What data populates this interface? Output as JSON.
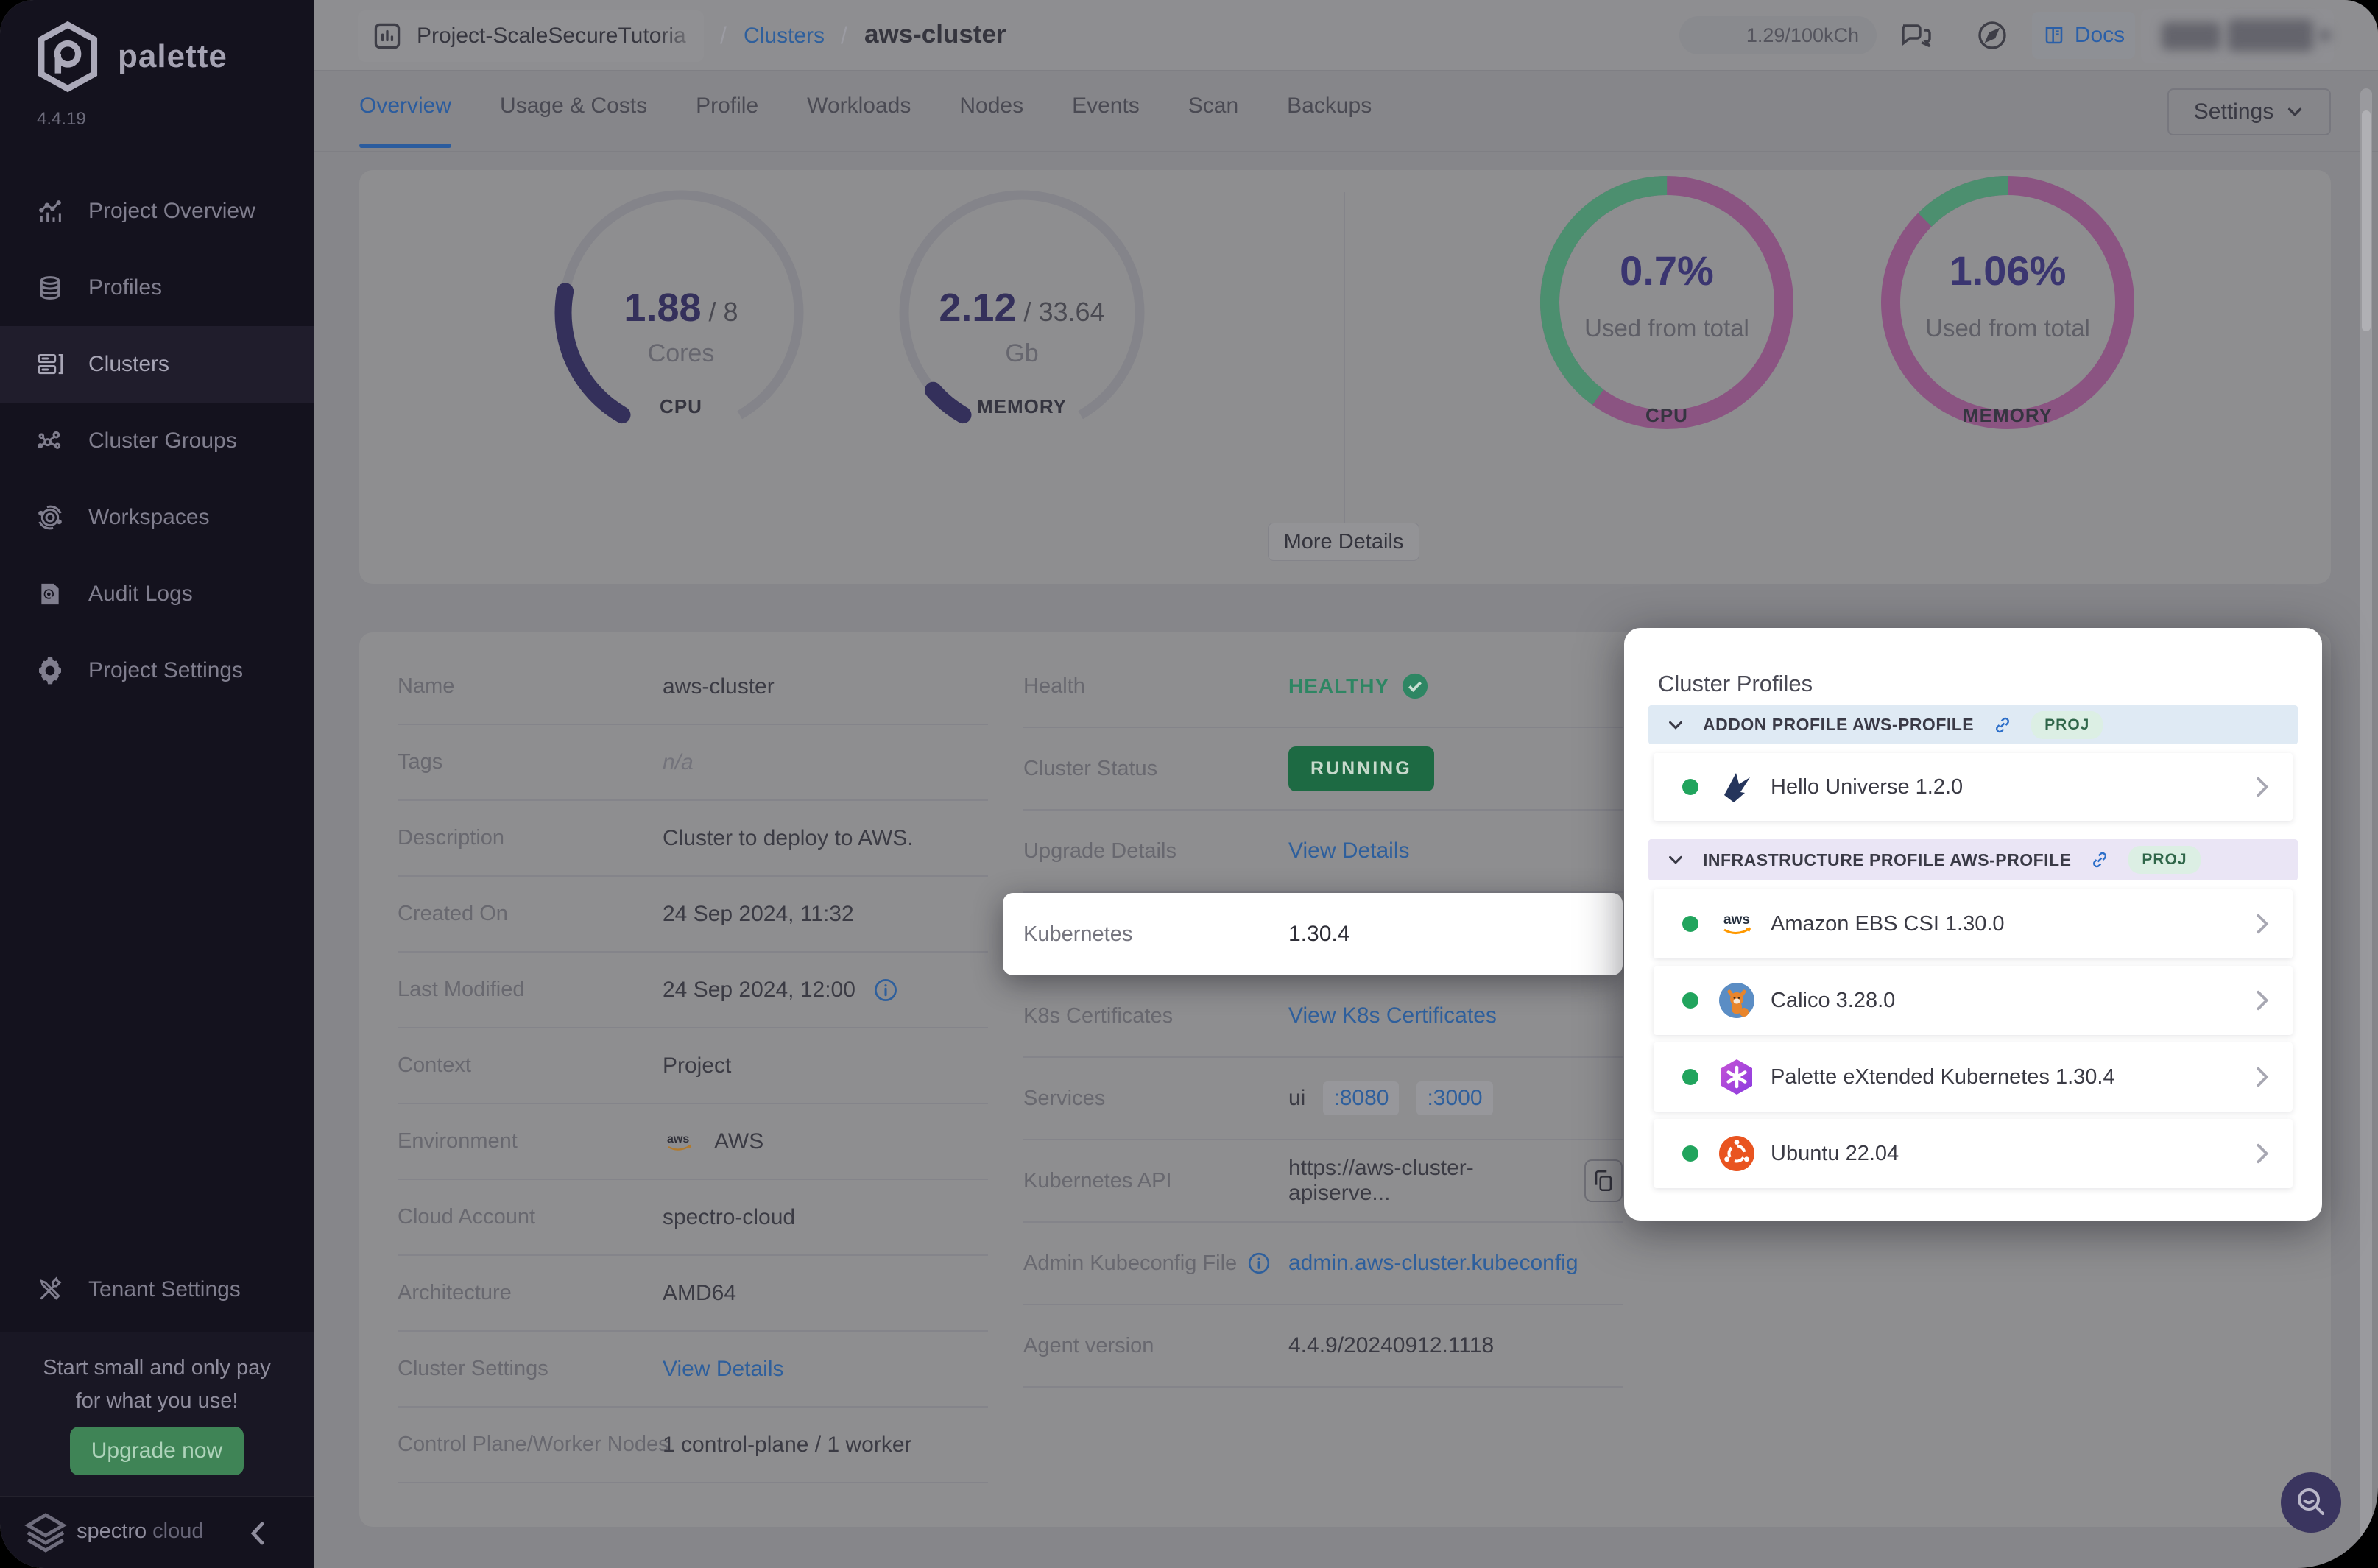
{
  "colors": {
    "accent_blue": "#2E5F9C",
    "panel_link_blue": "#2D6FC9",
    "healthy_green": "#2E8663",
    "running_badge_bg": "#1D6A43",
    "upgrade_button_green": "#3F8456",
    "gauge_indigo": "#34305B",
    "donut_green": "#4C8F6F",
    "donut_magenta": "#8B5482",
    "status_dot_green": "#21A45D",
    "fab_purple": "#3A355F"
  },
  "sidebar": {
    "brand": "palette",
    "version": "4.4.19",
    "items": [
      {
        "label": "Project Overview"
      },
      {
        "label": "Profiles"
      },
      {
        "label": "Clusters"
      },
      {
        "label": "Cluster Groups"
      },
      {
        "label": "Workspaces"
      },
      {
        "label": "Audit Logs"
      },
      {
        "label": "Project Settings"
      }
    ],
    "active_item": "Clusters",
    "tenant_settings": "Tenant Settings",
    "promo": {
      "text": "Start small and only pay for what you use!",
      "button": "Upgrade now"
    },
    "footer": {
      "brand1": "spectro",
      "brand2": "cloud"
    }
  },
  "topbar": {
    "project": "Project-ScaleSecureTutoria",
    "sep1": "/",
    "breadcrumb_link": "Clusters",
    "sep2": "/",
    "breadcrumb_current": "aws-cluster",
    "usage_badge": "1.29/100kCh",
    "docs_label": "Docs"
  },
  "tabs": {
    "items": [
      "Overview",
      "Usage & Costs",
      "Profile",
      "Workloads",
      "Nodes",
      "Events",
      "Scan",
      "Backups"
    ],
    "active": "Overview",
    "settings_button": "Settings"
  },
  "metrics": {
    "cpu_gauge": {
      "value": "1.88",
      "total": "/ 8",
      "unit": "Cores",
      "label": "CPU",
      "fraction": 0.235
    },
    "memory_gauge": {
      "value": "2.12",
      "total": "/ 33.64",
      "unit": "Gb",
      "label": "MEMORY",
      "fraction": 0.063
    },
    "cpu_donut": {
      "percent": "0.7%",
      "caption": "Used from total",
      "label": "CPU",
      "green_fraction": 0.4
    },
    "memory_donut": {
      "percent": "1.06%",
      "caption": "Used from total",
      "label": "MEMORY",
      "green_fraction": 0.125
    },
    "more_details": "More Details"
  },
  "details": {
    "left": [
      {
        "label": "Name",
        "value": "aws-cluster"
      },
      {
        "label": "Tags",
        "value": "n/a"
      },
      {
        "label": "Description",
        "value": "Cluster to deploy to AWS."
      },
      {
        "label": "Created On",
        "value": "24 Sep 2024, 11:32"
      },
      {
        "label": "Last Modified",
        "value": "24 Sep 2024, 12:00"
      },
      {
        "label": "Context",
        "value": "Project"
      },
      {
        "label": "Environment",
        "value": "AWS"
      },
      {
        "label": "Cloud Account",
        "value": "spectro-cloud"
      },
      {
        "label": "Architecture",
        "value": "AMD64"
      },
      {
        "label": "Cluster Settings",
        "value": "View Details"
      },
      {
        "label": "Control Plane/Worker Nodes",
        "value": "1 control-plane / 1 worker"
      }
    ],
    "right": {
      "health": {
        "label": "Health",
        "value": "HEALTHY"
      },
      "status": {
        "label": "Cluster Status",
        "value": "RUNNING"
      },
      "upgrade": {
        "label": "Upgrade Details",
        "value": "View Details"
      },
      "kubernetes": {
        "label": "Kubernetes",
        "value": "1.30.4"
      },
      "certs": {
        "label": "K8s Certificates",
        "value": "View K8s Certificates"
      },
      "services": {
        "label": "Services",
        "prefix": "ui",
        "ports": [
          ":8080",
          ":3000"
        ]
      },
      "api": {
        "label": "Kubernetes API",
        "value": "https://aws-cluster-apiserve..."
      },
      "kubeconfig": {
        "label": "Admin Kubeconfig File",
        "value": "admin.aws-cluster.kubeconfig"
      },
      "agent": {
        "label": "Agent version",
        "value": "4.4.9/20240912.1118"
      }
    }
  },
  "profiles_panel": {
    "title": "Cluster Profiles",
    "sections": [
      {
        "header": "ADDON PROFILE AWS-PROFILE",
        "badge": "PROJ",
        "items": [
          {
            "name": "Hello Universe 1.2.0"
          }
        ]
      },
      {
        "header": "INFRASTRUCTURE PROFILE AWS-PROFILE",
        "badge": "PROJ",
        "items": [
          {
            "name": "Amazon EBS CSI 1.30.0"
          },
          {
            "name": "Calico 3.28.0"
          },
          {
            "name": "Palette eXtended Kubernetes 1.30.4"
          },
          {
            "name": "Ubuntu 22.04"
          }
        ]
      }
    ]
  }
}
